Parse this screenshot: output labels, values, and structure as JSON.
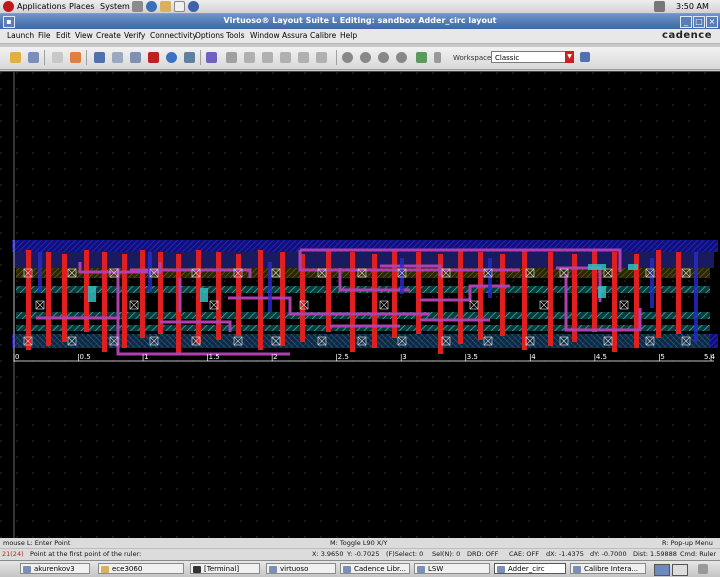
{
  "panel": {
    "menus": [
      "Applications",
      "Places",
      "System"
    ],
    "clock": "3:50 AM"
  },
  "window": {
    "title": "Virtuoso® Layout Suite L Editing: sandbox Adder_circ layout",
    "brand": "cadence"
  },
  "menubar": [
    "Launch",
    "File",
    "Edit",
    "View",
    "Create",
    "Verify",
    "Connectivity",
    "Options",
    "Tools",
    "Window",
    "Assura",
    "Calibre",
    "Help"
  ],
  "toolbar": {
    "workspace_label": "Workspace:",
    "workspace_value": "Classic"
  },
  "ruler": {
    "ticks": [
      "0",
      "0.5",
      "1",
      "1.5",
      "2",
      "2.5",
      "3",
      "3.5",
      "4",
      "4.5",
      "5",
      "5.4"
    ]
  },
  "status": {
    "mouse_left": "mouse L: Enter Point",
    "mouse_middle": "M: Toggle L90 X/Y",
    "mouse_right": "R: Pop-up Menu",
    "line_no": "21(24)",
    "prompt": "Point at the first point of the ruler:",
    "x": "X: 3.9650",
    "y": "Y: -0.7025",
    "select": "(F)Select: 0",
    "sel_n": "Sel(N): 0",
    "drd": "DRD: OFF",
    "cae": "CAE: OFF",
    "dx": "dX: -1.4375",
    "dy": "dY: -0.7000",
    "dist": "Dist: 1.59888",
    "cmd": "Cmd: Ruler"
  },
  "taskbar": [
    "akurenkov3",
    "ece3060",
    "[Terminal]",
    "virtuoso",
    "Cadence Libr...",
    "LSW",
    "Adder_circ",
    "Calibre Intera..."
  ],
  "colors": {
    "canvas": "#000000",
    "poly": "#e02020",
    "metal1": "#2828c8",
    "metal2": "#b040b0",
    "diffusion": "#20a0a0"
  }
}
